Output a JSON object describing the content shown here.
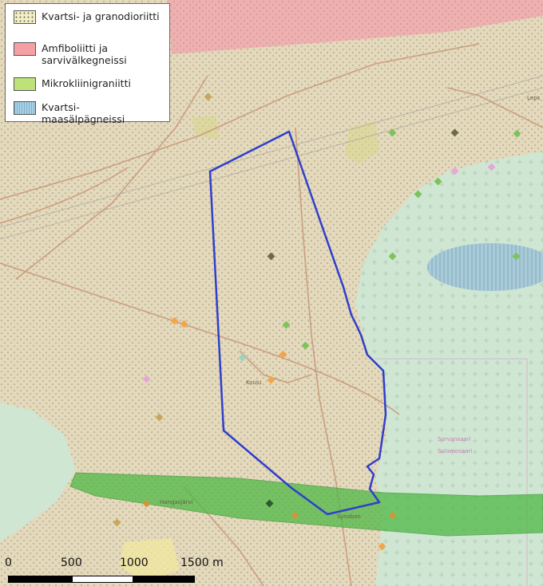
{
  "legend": {
    "items": [
      {
        "label": "Kvartsi- ja granodioriitti",
        "color": "#f3efc3",
        "pattern": "dots"
      },
      {
        "label": "Amfiboliitti ja sarvivälkegneissi",
        "color": "#f4a0a5",
        "pattern": "solid"
      },
      {
        "label": "Mikrokliinigraniitti",
        "color": "#bde27a",
        "pattern": "solid"
      },
      {
        "label": "Kvartsi-maasälpägneissi",
        "color": "#a9d2e8",
        "pattern": "stripes"
      }
    ]
  },
  "scalebar": {
    "ticks": [
      "0",
      "500",
      "1000",
      "1500 m"
    ]
  },
  "map_labels": {
    "place_1": "Leps",
    "place_2": "Hangasjärvi",
    "place_3": "Synsbon",
    "place_4": "Sorvansaari",
    "place_5": "Sulamosaari",
    "place_6": "Koulu"
  },
  "colors": {
    "terrain": "#e7dcc0",
    "lake": "#cfe6d3",
    "boundary": "#2f3fcc",
    "granite_band": "#55b84a",
    "amfibolite": "#f4a0a5"
  }
}
